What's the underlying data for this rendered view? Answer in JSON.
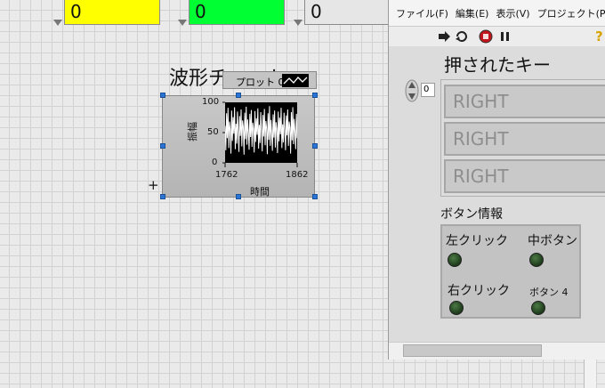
{
  "indicators": [
    {
      "value": "0",
      "color": "#ffff00"
    },
    {
      "value": "0",
      "color": "#00ff33"
    },
    {
      "value": "0",
      "color": "#e6e6e6"
    }
  ],
  "chart": {
    "title": "波形チャート",
    "legend_label": "プロット 0",
    "ylabel": "振幅",
    "xlabel": "時間",
    "y_ticks": [
      "100",
      "50",
      "0"
    ],
    "x_ticks": [
      "1762",
      "1862"
    ]
  },
  "chart_data": {
    "type": "line",
    "title": "波形チャート",
    "xlabel": "時間",
    "ylabel": "振幅",
    "xlim": [
      1762,
      1862
    ],
    "ylim": [
      0,
      100
    ],
    "series": [
      {
        "name": "プロット 0",
        "values": [
          62,
          18,
          85,
          40,
          95,
          22,
          70,
          55,
          12,
          90,
          35,
          78,
          48,
          96,
          20,
          66,
          30,
          88,
          52,
          15,
          80,
          44,
          92,
          25,
          72,
          60,
          10,
          86,
          38,
          97,
          28,
          74,
          50,
          19,
          84,
          42,
          91,
          24,
          68,
          57,
          14,
          89,
          33,
          76,
          46,
          94,
          21,
          64,
          31,
          87,
          53,
          16,
          82,
          43,
          93,
          27,
          71,
          58,
          11,
          85,
          37,
          98,
          26,
          73,
          49,
          17,
          83,
          41,
          90,
          23,
          69,
          56,
          13,
          88,
          34,
          77,
          47,
          95,
          22,
          65,
          32,
          86,
          54,
          18,
          81,
          45,
          92,
          26,
          70,
          59,
          12,
          87,
          36,
          96,
          29,
          75,
          51,
          20,
          84,
          40
        ]
      }
    ]
  },
  "menu": {
    "file": "ファイル(F)",
    "edit": "編集(E)",
    "view": "表示(V)",
    "project": "プロジェクト(P)"
  },
  "toolbar": {
    "help_glyph": "?"
  },
  "pressed_key": {
    "title": "押されたキー",
    "index": "0",
    "values": [
      "RIGHT",
      "RIGHT",
      "RIGHT"
    ]
  },
  "button_info": {
    "title": "ボタン情報",
    "left_click": "左クリック",
    "middle_button": "中ボタン",
    "right_click": "右クリック",
    "button4": "ボタン 4"
  },
  "cursor_glyph": "+",
  "colors": {
    "led_off": "#2f5a2c",
    "selection": "#2a74d6",
    "plot_bg": "#000000",
    "plot_line": "#ffffff"
  }
}
